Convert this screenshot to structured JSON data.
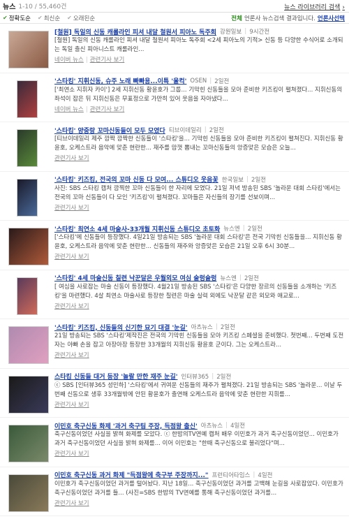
{
  "header": {
    "title": "뉴스",
    "count": "1-10 / 55,460건",
    "library_label": "뉴스 라이브러리 검색",
    "library_icon": "chevron-right-icon"
  },
  "sort": {
    "options": [
      {
        "label": "정확도순",
        "active": true
      },
      {
        "label": "최신순",
        "active": false
      },
      {
        "label": "오래된순",
        "active": false
      }
    ],
    "all_label": "전체",
    "press_text": "언론사 뉴스검색 결과입니다.",
    "select_label": "언론사선택"
  },
  "items": [
    {
      "title": "[철원] 독일의 신동 캐롤라인 피셔 내달 철원서 피아노 독주회",
      "source": "강원일보",
      "date": "9시간전",
      "desc": "[철원] 독일의 신동 캐롤라인 피셔 내달 철원서 피아노 독주회 <2세 피아노의 기적> 신동 등 다양한 수식어로 소개되는 독일 출신 피아니스트 캐롤라인...",
      "links": [
        "네이버 뉴스",
        "관련기사 보기"
      ],
      "thumb_colors": [
        "#c9a896",
        "#8a5a44"
      ]
    },
    {
      "title": "'스타킹' 지휘신동, 슈주 노래 빠빠용...이특 '울컥'",
      "source": "OSEN",
      "date": "2일전",
      "desc": "['최연소 지휘자 카이'] 2세 지휘신동 황윤호가 그룹... 기막힌 신동들을 모아 준비한 키즈킹이 펼쳐졌다... 지휘신동의 좌석이 잡은 뒤 지휘신동은 무표정으로 가만히 있어 웃음을 자아냈다...",
      "links": [
        "네이버 뉴스",
        "관련기사 보기"
      ],
      "thumb_colors": [
        "#3a2a3a",
        "#b04040"
      ]
    },
    {
      "title": "'스타킹' 양중랑 꼬마신동들이 모두 모였다",
      "source": "티브이데일리",
      "date": "2일전",
      "desc": "[티브이데일리 제주 깜짝 깜짝한 신동들이 '스타킹'을... 기막힌 신동들을 모아 준비한 키즈킹이 펼쳐진다. 지휘신동 황윤호, 오케스트라 음악에 맞춘 현란한... 재주를 맘껏 뽐내는 꼬마신동들의 앙증맞은 모습은 오늘...",
      "links": [
        "관련기사 보기"
      ],
      "thumb_colors": [
        "#2a3a2a",
        "#5a8a3a"
      ]
    },
    {
      "title": "'스타킹' 키즈킹, 전국의 꼬마 신동 다 모여... 스튜디오 웃음꽃",
      "source": "한국일보",
      "date": "2일전",
      "desc": "사진: SBS 스타킹 캡처 깜찍한 꼬마 신동들이 한 자리에 모였다. 21일 저녁 방송된 SBS '놀라운 대회 스타킹'에서는 전국의 꼬마 신동들이 다 모인 '키즈킹'이 펼쳐졌다. 꼬마들은 자신들의 장기를 선보이며...",
      "links": [
        "관련기사 보기"
      ],
      "thumb_colors": [
        "#1a1a2a",
        "#4a6a9a"
      ]
    },
    {
      "title": "'스타킹' 최연소 4세 마술사-33개월 지휘신동 스튜디오 초토화",
      "source": "뉴스엔",
      "date": "2일전",
      "desc": "['스타킹'에 신동들이 등장했다. 4일21일 방송되는 SBS '놀라운 대회 스타킹'은 전국 기막힌 신동들을... 지휘신동 황윤호, 오케스트라 음악에 맞춘 현란한... 신동들의 재주와 앙증맞은 모습은 21일 오후 6시 30분...",
      "links": [
        "관련기사 보기"
      ],
      "thumb_colors": [
        "#2a1a1a",
        "#b05a3a"
      ]
    },
    {
      "title": "'스타킹' 4세 마술신동 칠련 낙꾼달은 우월외모 여심 술렁술렁",
      "source": "뉴스엔",
      "date": "2일전",
      "desc": "[ 여심을 사로잡는 마술 신동이 등장했다. 4월21일 방송된 SBS '스타킹'은 다양한 장르의 신동들을 소개하는 '키즈킹'을 마련했다. 4살 최연소 마술사로 등장한 칠련은 마술 실력 외에도 낙꾼달 같은 외모와 애교로...",
      "links": [
        "관련기사 보기"
      ],
      "thumb_colors": [
        "#5a3a5a",
        "#d06a5a"
      ]
    },
    {
      "title": "'스타킹' 키즈킹, 신동들의 신기한 묘기 대결 '눈길'",
      "source": "아츠뉴스",
      "date": "2일전",
      "desc": "21일 방송되는 SBS '스타킹'제작진은 전국의 기막힌 신동들을 모아 키즈킹 스페셜을 준비했다. 첫번째... 두번째 도전자는 아빠 손을 잡고 아장아장 등장한 33개월의 지휘신동 황윤호 군이다. 그는 오케스트라...",
      "links": [
        "관련기사 보기"
      ],
      "thumb_colors": [
        "#b08ab0",
        "#e0a0c0"
      ]
    },
    {
      "title": "스타킹 신동들 대거 등장 '놀랄 만한 재주 눈길'",
      "source": "인터뷰365",
      "date": "2일전",
      "desc": "ⓒ SBS [인터뷰365 성민하] '스타킹'에서 귀여운 신동들의 재주가 펼쳐졌다. 21일 방송되는 SBS '놀라운... 이날 두 번째 신동으로 생후 33개월밖에 안된 황윤호가 출연해 오케스트라 음악에 맞춘 현란한 지휘를...",
      "links": [
        "관련기사 보기"
      ],
      "thumb_colors": [
        "#1a1a1a",
        "#3a3a5a"
      ]
    },
    {
      "title": "이민호 축구신동 화제 '과거 축구팀 주장, 득점왕 출신'",
      "source": "아츠뉴스",
      "date": "4일전",
      "desc": "축구신동이었던 사실을 밝혀 화제를 모았다. ⓒ 한밤의TV연예 캡처 배우 이민호가 과거 축구신동이었던... 이민호가 과거 축구신동이었던 사실을 밝혀 화제를... 이어 이민호는 \"한때 축구신동으로 불리었다\"며...",
      "links": [
        "관련기사 보기"
      ],
      "thumb_colors": [
        "#3a5a3a",
        "#7a8a6a"
      ]
    },
    {
      "title": "이민호 축구신동 과거 화제 \"득점왕에 축구부 주장까지...\"",
      "source": "프런티어타임스",
      "date": "4일전",
      "desc": "이민호가 축구신동이었던 과거를 털어놨다. 지난 18일... 축구신동이었던 과거를 고백해 눈길을 사로잡았다. 이민호가 축구신동이었던 과거를 들... (사진=SBS 한밤의 TV연예를 통해 축구신동이었던 과거를...",
      "links": [
        "관련기사 보기"
      ],
      "thumb_colors": [
        "#4a4a3a",
        "#8a7a5a"
      ]
    }
  ]
}
